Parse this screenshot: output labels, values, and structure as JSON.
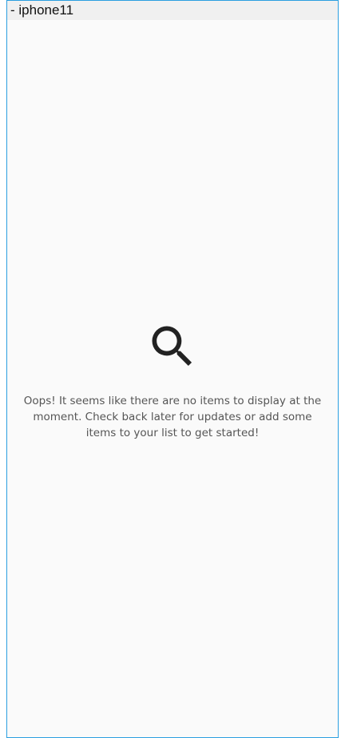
{
  "device": {
    "label": "- iphone11"
  },
  "empty_state": {
    "icon": "search-icon",
    "message": "Oops! It seems like there are no items to display at the moment. Check back later for updates or add some items to your list to get started!"
  },
  "colors": {
    "frame_border": "#2b9fe0",
    "background": "#fafafa",
    "title_bar": "#f0f0f0",
    "icon": "#222222",
    "text": "#555555"
  }
}
